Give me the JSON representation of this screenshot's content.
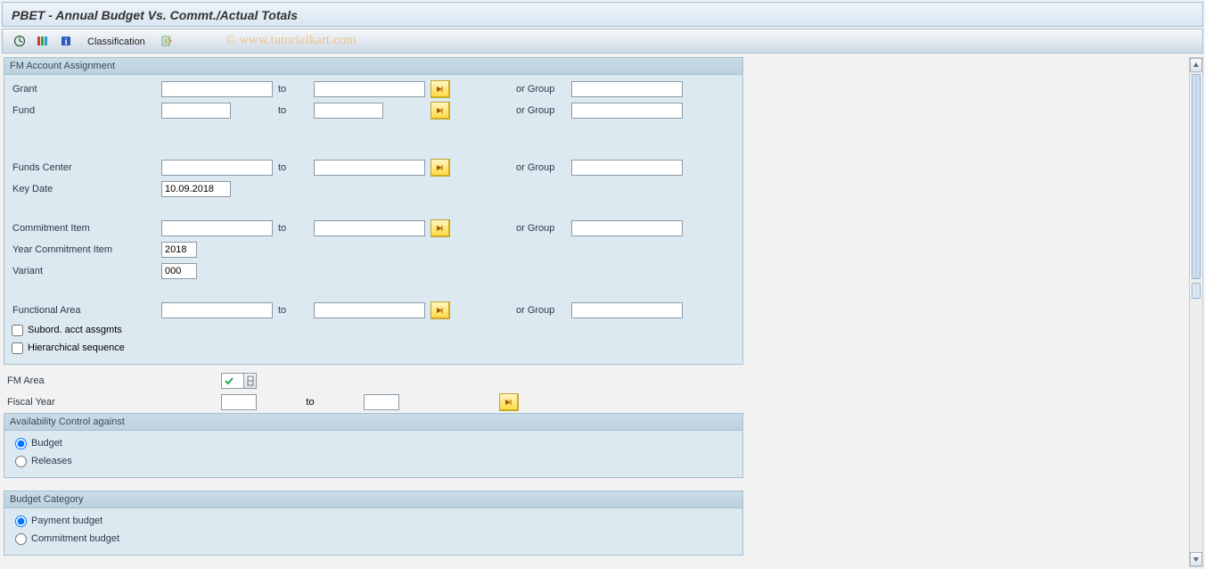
{
  "title": "PBET - Annual Budget Vs. Commt./Actual Totals",
  "toolbar": {
    "classification_label": "Classification"
  },
  "watermark": "©  www.tutorialkart.com",
  "group_fm": {
    "title": "FM Account Assignment",
    "grant_label": "Grant",
    "fund_label": "Fund",
    "funds_center_label": "Funds Center",
    "key_date_label": "Key Date",
    "key_date_value": "10.09.2018",
    "commitment_item_label": "Commitment Item",
    "year_ci_label": "Year Commitment Item",
    "year_ci_value": "2018",
    "variant_label": "Variant",
    "variant_value": "000",
    "functional_area_label": "Functional Area",
    "subord_label": "Subord. acct assgmts",
    "hier_label": "Hierarchical sequence",
    "to_label": "to",
    "orgroup_label": "or Group"
  },
  "plain": {
    "fm_area_label": "FM Area",
    "fiscal_year_label": "Fiscal Year",
    "to_label": "to"
  },
  "group_avc": {
    "title": "Availability Control against",
    "budget_label": "Budget",
    "releases_label": "Releases"
  },
  "group_bcat": {
    "title": "Budget Category",
    "payment_label": "Payment budget",
    "commitment_label": "Commitment budget"
  }
}
